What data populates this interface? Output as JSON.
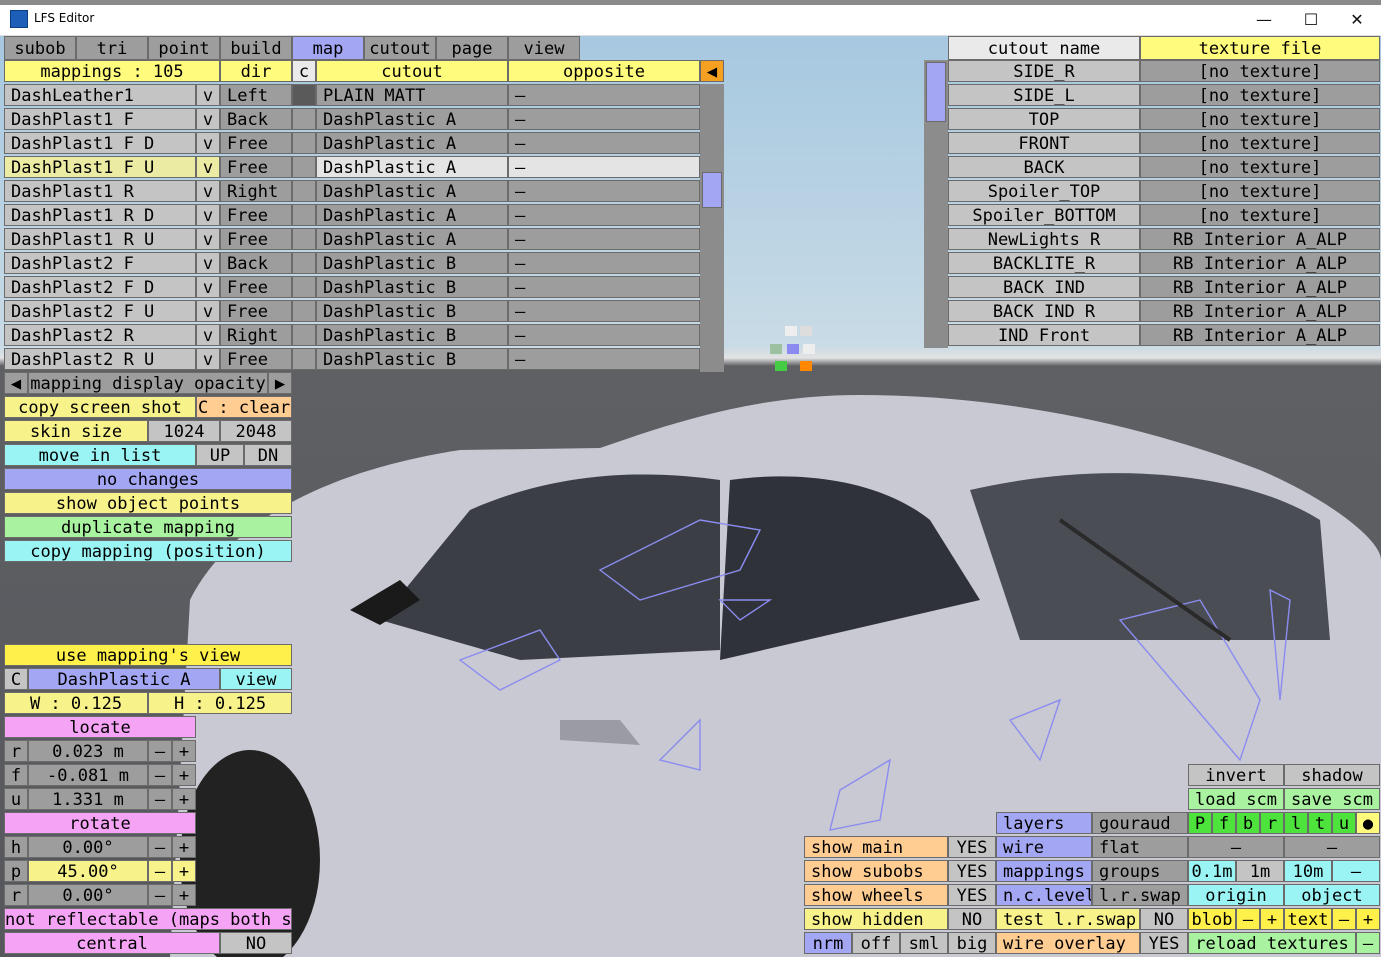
{
  "window": {
    "title": "LFS Editor",
    "min": "—",
    "max": "☐",
    "close": "✕"
  },
  "menu": [
    "subob",
    "tri",
    "point",
    "build",
    "map",
    "cutout",
    "page",
    "view"
  ],
  "mapping_table": {
    "header": {
      "mappings": "mappings : 105",
      "dir": "dir",
      "c": "c",
      "cutout": "cutout",
      "opposite": "opposite"
    },
    "scroll_arrow": "◀",
    "rows": [
      {
        "name": "DashLeather1",
        "v": "v",
        "dir": "Left",
        "cutout": "PLAIN MATT",
        "opposite": "–"
      },
      {
        "name": "DashPlast1 F",
        "v": "v",
        "dir": "Back",
        "cutout": "DashPlastic A",
        "opposite": "–"
      },
      {
        "name": "DashPlast1 F D",
        "v": "v",
        "dir": "Free",
        "cutout": "DashPlastic A",
        "opposite": "–"
      },
      {
        "name": "DashPlast1 F U",
        "v": "v",
        "dir": "Free",
        "cutout": "DashPlastic A",
        "opposite": "–"
      },
      {
        "name": "DashPlast1 R",
        "v": "v",
        "dir": "Right",
        "cutout": "DashPlastic A",
        "opposite": "–"
      },
      {
        "name": "DashPlast1 R D",
        "v": "v",
        "dir": "Free",
        "cutout": "DashPlastic A",
        "opposite": "–"
      },
      {
        "name": "DashPlast1 R U",
        "v": "v",
        "dir": "Free",
        "cutout": "DashPlastic A",
        "opposite": "–"
      },
      {
        "name": "DashPlast2 F",
        "v": "v",
        "dir": "Back",
        "cutout": "DashPlastic B",
        "opposite": "–"
      },
      {
        "name": "DashPlast2 F D",
        "v": "v",
        "dir": "Free",
        "cutout": "DashPlastic B",
        "opposite": "–"
      },
      {
        "name": "DashPlast2 F U",
        "v": "v",
        "dir": "Free",
        "cutout": "DashPlastic B",
        "opposite": "–"
      },
      {
        "name": "DashPlast2 R",
        "v": "v",
        "dir": "Right",
        "cutout": "DashPlastic B",
        "opposite": "–"
      },
      {
        "name": "DashPlast2 R U",
        "v": "v",
        "dir": "Free",
        "cutout": "DashPlastic B",
        "opposite": "–"
      }
    ],
    "selected_index": 3
  },
  "cutout_table": {
    "header": {
      "name": "cutout name",
      "texture": "texture file"
    },
    "rows": [
      {
        "name": "SIDE_R",
        "texture": "[no texture]"
      },
      {
        "name": "SIDE_L",
        "texture": "[no texture]"
      },
      {
        "name": "TOP",
        "texture": "[no texture]"
      },
      {
        "name": "FRONT",
        "texture": "[no texture]"
      },
      {
        "name": "BACK",
        "texture": "[no texture]"
      },
      {
        "name": "Spoiler_TOP",
        "texture": "[no texture]"
      },
      {
        "name": "Spoiler_BOTTOM",
        "texture": "[no texture]"
      },
      {
        "name": "NewLights R",
        "texture": "RB Interior A_ALP"
      },
      {
        "name": "BACKLITE_R",
        "texture": "RB Interior A_ALP"
      },
      {
        "name": "BACK IND",
        "texture": "RB Interior A_ALP"
      },
      {
        "name": "BACK IND R",
        "texture": "RB Interior A_ALP"
      },
      {
        "name": "IND Front",
        "texture": "RB Interior A_ALP"
      }
    ]
  },
  "left_panel": {
    "opacity_left": "◀",
    "opacity_label": "mapping display opacity",
    "opacity_right": "▶",
    "copy_screenshot": "copy screen shot",
    "clear": "C : clear",
    "skin_size": "skin size",
    "skin_1024": "1024",
    "skin_2048": "2048",
    "move_in_list": "move in list",
    "up": "UP",
    "dn": "DN",
    "no_changes": "no changes",
    "show_object_points": "show object points",
    "duplicate_mapping": "duplicate mapping",
    "copy_mapping": "copy mapping (position)"
  },
  "mapping_props": {
    "use_view": "use mapping's view",
    "c": "C",
    "cutout": "DashPlastic A",
    "view": "view",
    "w": "W : 0.125",
    "h": "H : 0.125",
    "locate": "locate",
    "pos": [
      {
        "axis": "r",
        "value": "0.023 m"
      },
      {
        "axis": "f",
        "value": "-0.081 m"
      },
      {
        "axis": "u",
        "value": "1.331 m"
      }
    ],
    "rotate": "rotate",
    "rot": [
      {
        "axis": "h",
        "value": "0.00°"
      },
      {
        "axis": "p",
        "value": "45.00°"
      },
      {
        "axis": "r",
        "value": "0.00°"
      }
    ],
    "minus": "–",
    "plus": "+",
    "not_reflectable": "not reflectable (maps both sides)",
    "central": "central",
    "central_val": "NO"
  },
  "bottom_right": {
    "show_main": "show main",
    "show_main_val": "YES",
    "show_subobs": "show subobs",
    "show_subobs_val": "YES",
    "show_wheels": "show wheels",
    "show_wheels_val": "YES",
    "show_hidden": "show hidden",
    "show_hidden_val": "NO",
    "nrm": "nrm",
    "off": "off",
    "sml": "sml",
    "big": "big",
    "layers": "layers",
    "gouraud": "gouraud",
    "wire": "wire",
    "flat": "flat",
    "mappings": "mappings",
    "groups": "groups",
    "nclevel": "n.c.level",
    "lrswap": "l.r.swap",
    "test_lr_swap": "test l.r.swap",
    "test_val": "NO",
    "wire_overlay": "wire overlay",
    "wire_overlay_val": "YES",
    "invert": "invert",
    "shadow": "shadow",
    "load_scm": "load scm",
    "save_scm": "save scm",
    "view_letters": [
      "P",
      "f",
      "b",
      "r",
      "l",
      "t",
      "u",
      "●"
    ],
    "dash1": "–",
    "dash2": "–",
    "d01": "0.1m",
    "d1": "1m",
    "d10": "10m",
    "dminus": "–",
    "origin": "origin",
    "object": "object",
    "blob": "blob",
    "text": "text",
    "reload_textures": "reload textures"
  }
}
